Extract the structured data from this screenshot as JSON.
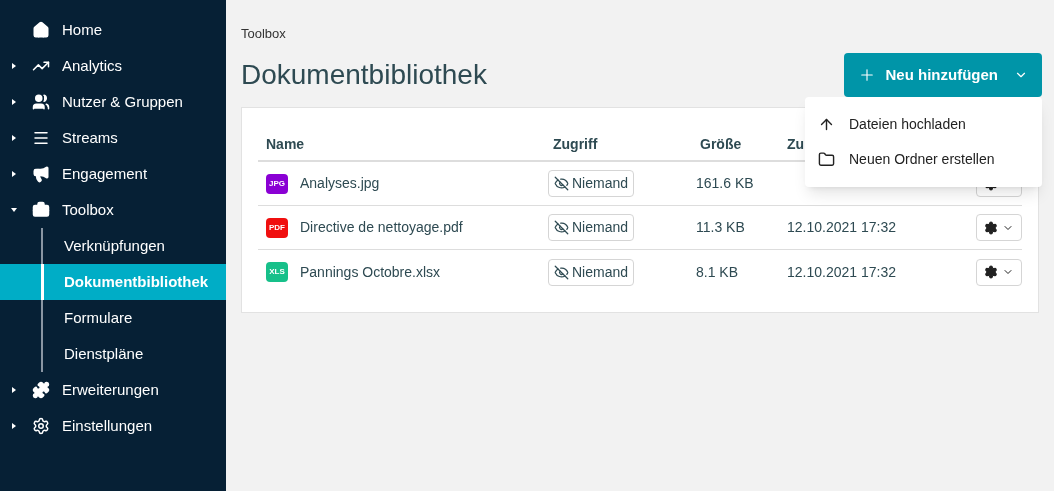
{
  "sidebar": {
    "items": [
      {
        "label": "Home"
      },
      {
        "label": "Analytics",
        "expanded": false
      },
      {
        "label": "Nutzer & Gruppen",
        "expanded": false
      },
      {
        "label": "Streams",
        "expanded": false
      },
      {
        "label": "Engagement",
        "expanded": false
      },
      {
        "label": "Toolbox",
        "expanded": true,
        "children": [
          {
            "label": "Verknüpfungen",
            "selected": false
          },
          {
            "label": "Dokumentbibliothek",
            "selected": true
          },
          {
            "label": "Formulare",
            "selected": false
          },
          {
            "label": "Dienstpläne",
            "selected": false
          }
        ]
      },
      {
        "label": "Erweiterungen",
        "expanded": false
      },
      {
        "label": "Einstellungen",
        "expanded": false
      }
    ]
  },
  "breadcrumb": "Toolbox",
  "title": "Dokumentbibliothek",
  "add_button": {
    "label": "Neu hinzufügen"
  },
  "add_menu": {
    "open": true,
    "items": [
      {
        "label": "Dateien hochladen"
      },
      {
        "label": "Neuen Ordner erstellen"
      }
    ]
  },
  "table": {
    "columns": [
      "Name",
      "Zugriff",
      "Größe",
      "Zu"
    ],
    "rows": [
      {
        "badge": "JPG",
        "color": "#8a00d4",
        "name": "Analyses.jpg",
        "access": "Niemand",
        "size": "161.6 KB"
      },
      {
        "badge": "PDF",
        "color": "#f00f0f",
        "name": "Directive de nettoyage.pdf",
        "access": "Niemand",
        "size": "11.3 KB",
        "date": "12.10.2021 17:32"
      },
      {
        "badge": "XLS",
        "color": "#17c08a",
        "name": "Pannings Octobre.xlsx",
        "access": "Niemand",
        "size": "8.1 KB",
        "date": "12.10.2021 17:32"
      }
    ]
  }
}
